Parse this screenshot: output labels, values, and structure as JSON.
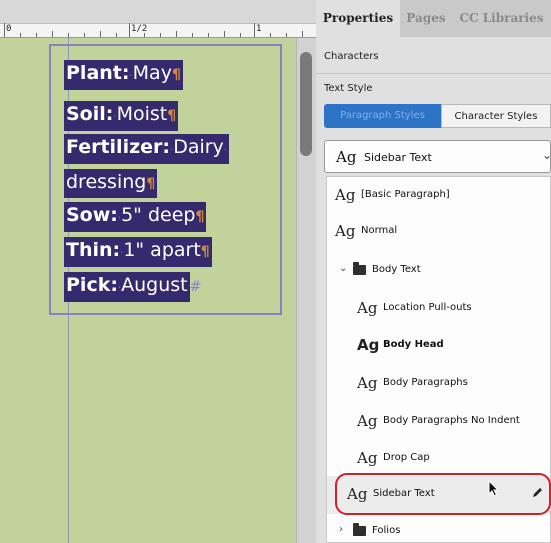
{
  "panel": {
    "tabs": [
      "Properties",
      "Pages",
      "CC Libraries"
    ],
    "section_characters": "Characters",
    "section_text_style": "Text Style",
    "style_tabs": [
      "Paragraph Styles",
      "Character Styles"
    ],
    "dropdown_icon": "Ag",
    "dropdown_value": "Sidebar Text",
    "styles_list": [
      {
        "icon": "Ag",
        "label": "[Basic Paragraph]"
      },
      {
        "icon": "Ag",
        "label": "Normal"
      },
      {
        "folder": true,
        "label": "Body Text",
        "expanded": true
      },
      {
        "icon": "Ag",
        "label": "Location Pull-outs"
      },
      {
        "icon": "Ag",
        "label": "Body Head",
        "bold": true
      },
      {
        "icon": "Ag",
        "label": "Body Paragraphs"
      },
      {
        "icon": "Ag",
        "label": "Body Paragraphs No Indent"
      },
      {
        "icon": "Ag",
        "label": "Drop Cap"
      },
      {
        "icon": "Ag",
        "label": "Sidebar Text",
        "selected": true
      },
      {
        "folder": true,
        "label": "Folios",
        "expanded": false
      }
    ]
  },
  "ruler": {
    "labels": [
      "0",
      "1/2",
      "1"
    ]
  },
  "document": {
    "lines": [
      {
        "key": "Plant:",
        "value": "May"
      },
      {
        "key": "Soil:",
        "value": "Moist"
      },
      {
        "key": "Fertilizer:",
        "value": "Dairy"
      },
      {
        "key": "",
        "value": "dressing"
      },
      {
        "key": "Sow:",
        "value": "5\" deep"
      },
      {
        "key": "Thin:",
        "value": "1\" apart"
      },
      {
        "key": "Pick:",
        "value": "August"
      }
    ]
  },
  "colors": {
    "canvas": "#c1d39a",
    "text_highlight": "#362a6e",
    "frame": "#8a80c3",
    "selection_accent": "#2d73c6",
    "annotation": "#d0202a"
  }
}
